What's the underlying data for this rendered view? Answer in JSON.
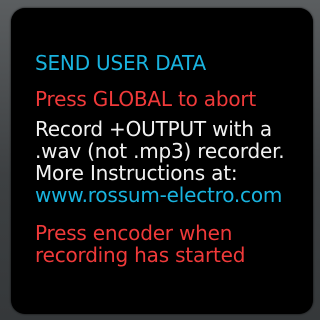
{
  "screen": {
    "colors": {
      "title": "#19b3df",
      "warning": "#f03a3a",
      "body": "#f2f2f2",
      "link": "#19b3df",
      "background": "#000000"
    },
    "lines": [
      "SEND USER DATA",
      "Press GLOBAL to abort",
      "Record +OUTPUT with a",
      ".wav (not .mp3) recorder.",
      "More Instructions at:",
      "www.rossum-electro.com",
      "Press encoder when",
      "recording has started"
    ]
  }
}
